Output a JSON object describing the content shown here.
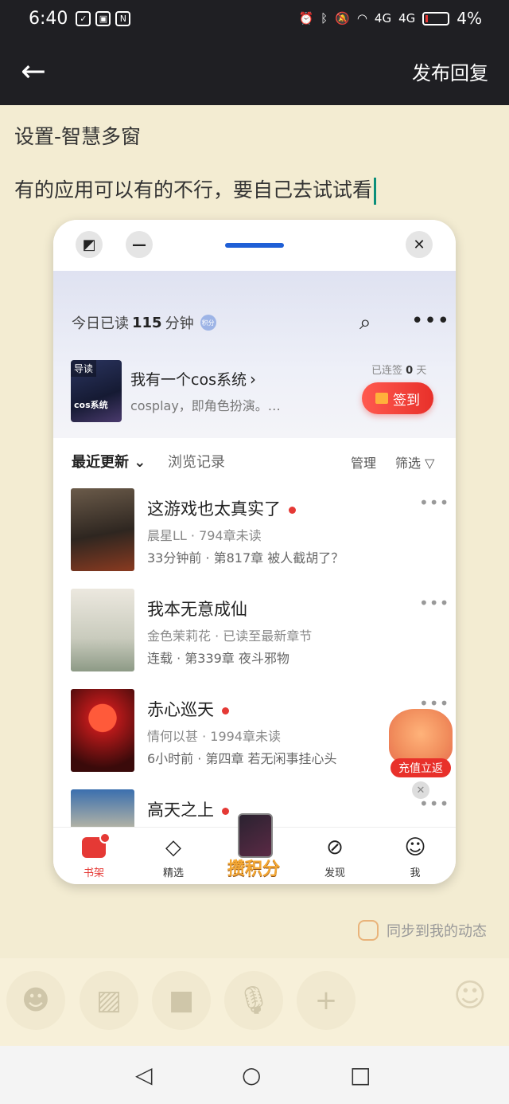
{
  "status": {
    "time": "6:40",
    "net_1": "4G",
    "net_2": "4G",
    "battery": "4%"
  },
  "appbar": {
    "publish_label": "发布回复"
  },
  "compose": {
    "line1": "设置-智慧多窗",
    "line2": "有的应用可以有的不行，要自己去试试看"
  },
  "window": {
    "hero": {
      "read_prefix": "今日已读",
      "read_minutes": "115",
      "read_suffix": "分钟",
      "points_badge": "积分"
    },
    "featured": {
      "cover_tag": "导读",
      "cover_text": "cos系统",
      "title": "我有一个cos系统",
      "desc": "cosplay，即角色扮演。…",
      "streak_prefix": "已连签",
      "streak_days": "0",
      "streak_suffix": "天",
      "signin_label": "签到"
    },
    "tabs": {
      "recent": "最近更新",
      "history": "浏览记录",
      "manage": "管理",
      "filter": "筛选"
    },
    "books": [
      {
        "title": "这游戏也太真实了",
        "meta": "晨星LL · 794章未读",
        "update": "33分钟前 · 第817章 被人截胡了？",
        "unread_dot": true
      },
      {
        "title": "我本无意成仙",
        "meta": "金色茉莉花 · 已读至最新章节",
        "update": "连载 · 第339章 夜斗邪物",
        "unread_dot": false
      },
      {
        "title": "赤心巡天",
        "meta": "情何以甚 · 1994章未读",
        "update": "6小时前 · 第四章 若无闲事挂心头",
        "unread_dot": true
      },
      {
        "title": "高天之上",
        "meta": "",
        "update": "",
        "unread_dot": true
      }
    ],
    "promo_label": "充值立返",
    "nav": {
      "shelf": "书架",
      "featured": "精选",
      "points": "攒积分",
      "discover": "发现",
      "me": "我"
    },
    "accent_color": "#e53935"
  },
  "sync_label": "同步到我的动态",
  "icons": [
    "back-arrow-icon",
    "emoji-icon",
    "image-icon",
    "video-icon",
    "mic-icon",
    "plus-icon",
    "anonymous-mask-icon",
    "search-icon",
    "more-icon",
    "close-icon"
  ]
}
